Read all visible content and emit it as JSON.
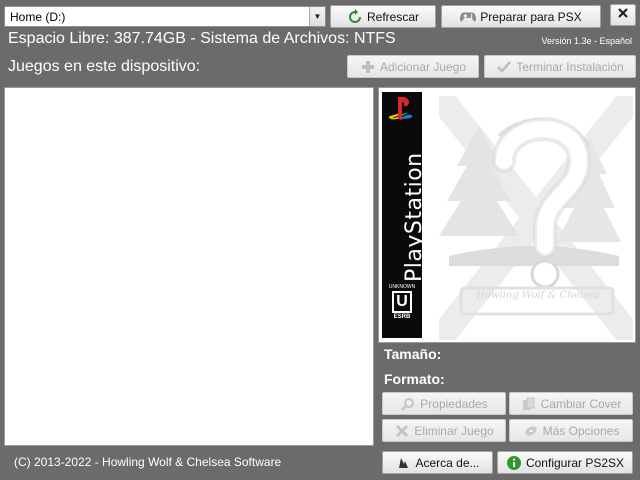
{
  "drive": {
    "selected": "Home (D:)"
  },
  "toolbar": {
    "refresh_label": "Refrescar",
    "prepare_label": "Preparar para PSX"
  },
  "status": {
    "free_space": "Espacio Libre: 387.74GB - Sistema de Archivos: NTFS",
    "version": "Versión 1.3e - Español"
  },
  "games": {
    "label": "Juegos en este dispositivo:",
    "add_label": "Adicionar Juego",
    "finish_label": "Terminar Instalación",
    "items": []
  },
  "cover": {
    "spine_text": "PlayStation",
    "rating_top": "UNKNOWN",
    "rating_letter": "U",
    "rating_brand": "ESRB",
    "watermark": "Howling Wolf & Chelsea"
  },
  "details": {
    "size_label": "Tamaño:",
    "format_label": "Formato:"
  },
  "actions": {
    "properties_label": "Propiedades",
    "change_cover_label": "Cambiar Cover",
    "delete_label": "Eliminar Juego",
    "more_label": "Más Opciones",
    "about_label": "Acerca de...",
    "configure_label": "Configurar PS2SX"
  },
  "footer": {
    "copyright": "(C) 2013-2022 - Howling Wolf & Chelsea Software"
  },
  "colors": {
    "background": "#6b6b6b",
    "panel": "#ffffff",
    "accent_green": "#2e9a2e"
  }
}
